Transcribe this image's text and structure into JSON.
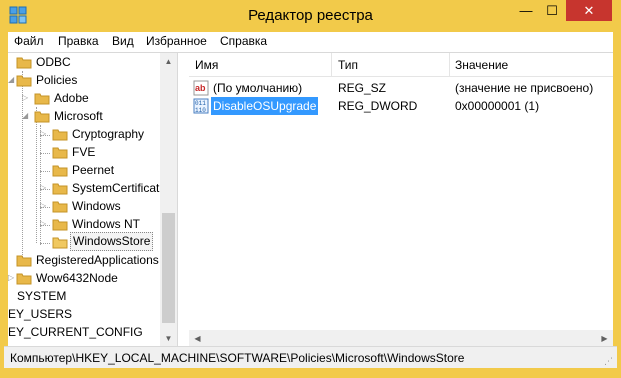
{
  "window": {
    "title": "Редактор реестра",
    "minimize": "—",
    "maximize": "☐",
    "close": "✕"
  },
  "menu": [
    "Файл",
    "Правка",
    "Вид",
    "Избранное",
    "Справка"
  ],
  "tree": {
    "items": [
      {
        "label": "ODBC",
        "expander": ""
      },
      {
        "label": "Policies",
        "expander": "◢"
      },
      {
        "label": "Adobe",
        "expander": "▷"
      },
      {
        "label": "Microsoft",
        "expander": "◢"
      },
      {
        "label": "Cryptography",
        "expander": "▷"
      },
      {
        "label": "FVE",
        "expander": ""
      },
      {
        "label": "Peernet",
        "expander": ""
      },
      {
        "label": "SystemCertificat",
        "expander": "▷"
      },
      {
        "label": "Windows",
        "expander": "▷"
      },
      {
        "label": "Windows NT",
        "expander": "▷"
      },
      {
        "label": "WindowsStore",
        "expander": ""
      },
      {
        "label": "RegisteredApplications",
        "expander": ""
      },
      {
        "label": "Wow6432Node",
        "expander": "▷"
      },
      {
        "label": "SYSTEM",
        "expander": "▷"
      },
      {
        "label": "KEY_USERS",
        "expander": ""
      },
      {
        "label": "KEY_CURRENT_CONFIG",
        "expander": ""
      }
    ]
  },
  "list": {
    "headers": {
      "name": "Имя",
      "type": "Тип",
      "value": "Значение"
    },
    "rows": [
      {
        "name": "(По умолчанию)",
        "type": "REG_SZ",
        "value": "(значение не присвоено)",
        "icon": "string-value-icon"
      },
      {
        "name": "DisableOSUpgrade",
        "type": "REG_DWORD",
        "value": "0x00000001 (1)",
        "icon": "dword-value-icon"
      }
    ]
  },
  "status": {
    "path": "Компьютер\\HKEY_LOCAL_MACHINE\\SOFTWARE\\Policies\\Microsoft\\WindowsStore"
  },
  "colors": {
    "titlebar": "#f2ca4a",
    "close": "#c7352e",
    "selection": "#3399ff",
    "folder": "#e8b84a"
  }
}
